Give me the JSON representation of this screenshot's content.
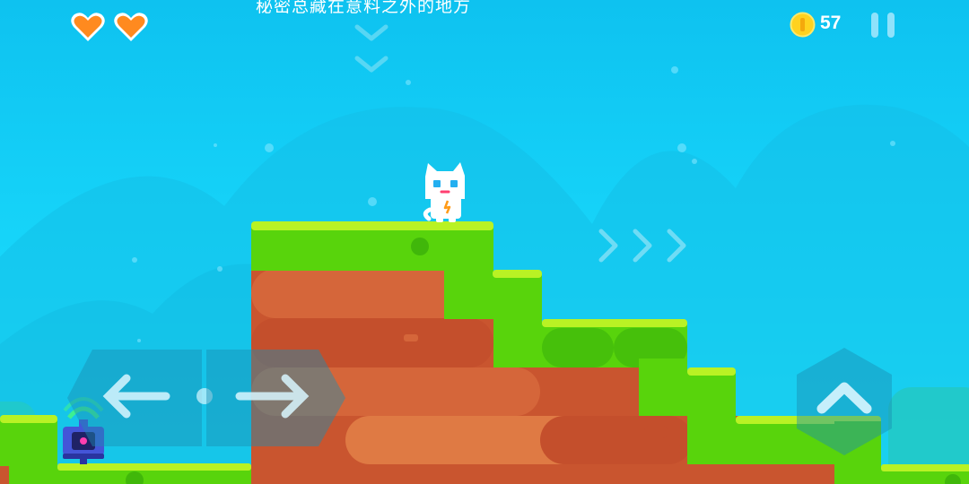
{
  "hud": {
    "lives": {
      "current": 2,
      "icon": "heart-icon",
      "color": "#ff8a1f"
    },
    "hint_text": "秘密总藏在意料之外的地方",
    "coins": {
      "count": "57",
      "icon": "coin-icon",
      "color": "#ffd21f"
    },
    "pause_icon": "pause-icon"
  },
  "controls": {
    "move_left_icon": "arrow-left-icon",
    "move_right_icon": "arrow-right-icon",
    "jump_icon": "chevron-up-icon"
  },
  "scene": {
    "player": "white-cat",
    "enemy": "blue-robot",
    "colors": {
      "grass": "#58d40c",
      "grass_top": "#b9f224",
      "dirt": "#d5663a",
      "sky": "#18d8fb"
    }
  }
}
